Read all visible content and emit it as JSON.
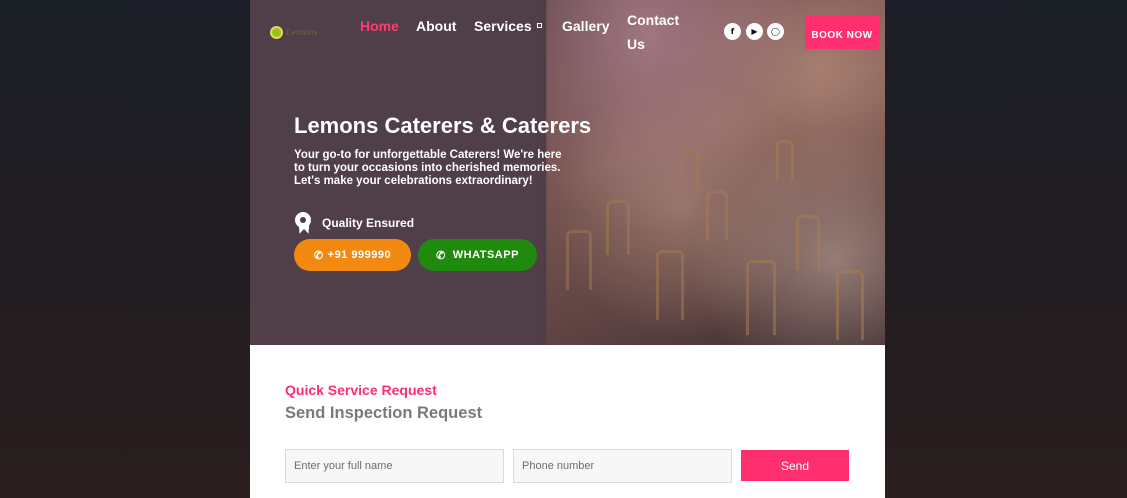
{
  "nav": {
    "logo_text": "Lemons",
    "items": [
      {
        "label": "Home"
      },
      {
        "label": "About"
      },
      {
        "label": "Services"
      },
      {
        "label": "Gallery"
      },
      {
        "label": "Contact Us"
      }
    ],
    "social_icons": [
      "facebook-icon",
      "youtube-icon",
      "instagram-icon"
    ],
    "book_label": "BOOK NOW"
  },
  "hero": {
    "title": "Lemons Caterers & Caterers",
    "description": "Your go-to for unforgettable Caterers! We're here to turn your occasions into cherished memories. Let's make your celebrations extraordinary!",
    "quality_label": "Quality Ensured",
    "phone_label": "+91 999990",
    "whatsapp_label": "WHATSAPP"
  },
  "request": {
    "kicker": "Quick Service Request",
    "title": "Send Inspection Request",
    "name_placeholder": "Enter your full name",
    "phone_placeholder": "Phone number",
    "send_label": "Send"
  },
  "colors": {
    "accent": "#ff2f6f",
    "phone_button": "#f28a12",
    "whatsapp_button": "#1f8a0e",
    "hero_overlay": "#4e3e46"
  }
}
